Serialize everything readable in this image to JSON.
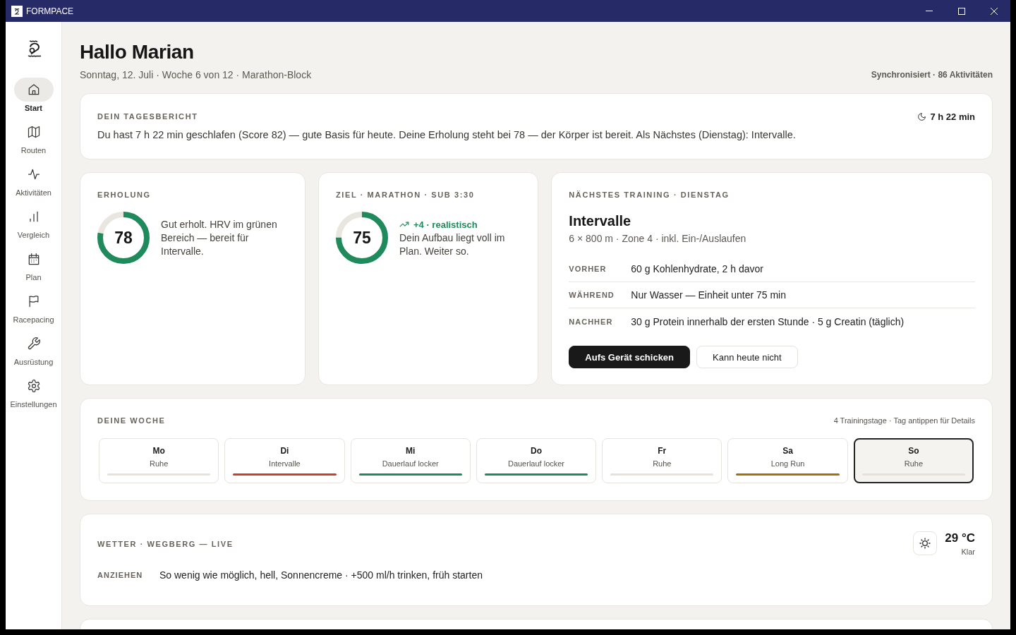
{
  "window": {
    "title": "FORMPACE"
  },
  "sidebar": {
    "items": [
      {
        "label": "Start",
        "selected": true
      },
      {
        "label": "Routen",
        "selected": false
      },
      {
        "label": "Aktivitäten",
        "selected": false
      },
      {
        "label": "Vergleich",
        "selected": false
      },
      {
        "label": "Plan",
        "selected": false
      },
      {
        "label": "Racepacing",
        "selected": false
      },
      {
        "label": "Ausrüstung",
        "selected": false
      },
      {
        "label": "Einstellungen",
        "selected": false
      }
    ]
  },
  "header": {
    "title": "Hallo Marian",
    "subtitle": "Sonntag, 12. Juli · Woche 6 von 12 · Marathon-Block",
    "sync_status": "Synchronisiert · 86 Aktivitäten"
  },
  "daily_report": {
    "heading": "DEIN TAGESBERICHT",
    "sleep": "7 h 22 min",
    "text": "Du hast 7 h 22 min geschlafen (Score 82) — gute Basis für heute. Deine Erholung steht bei 78 — der Körper ist bereit. Als Nächstes (Dienstag): Intervalle."
  },
  "recovery": {
    "heading": "ERHOLUNG",
    "score": "78",
    "level": 0.78,
    "text": "Gut erholt. HRV im grünen Bereich — bereit für Intervalle."
  },
  "goal": {
    "heading": "ZIEL · MARATHON · SUB 3:30",
    "score": "75",
    "level": 0.75,
    "trend": "+4 · realistisch",
    "text": "Dein Aufbau liegt voll im Plan. Weiter so."
  },
  "next_training": {
    "heading": "NÄCHSTES TRAINING · DIENSTAG",
    "title": "Intervalle",
    "details": "6 × 800 m · Zone 4 · inkl. Ein-/Auslaufen",
    "nutrition": [
      {
        "label": "VORHER",
        "text": "60 g Kohlenhydrate, 2 h davor"
      },
      {
        "label": "WÄHREND",
        "text": "Nur Wasser — Einheit unter 75 min"
      },
      {
        "label": "NACHHER",
        "text": "30 g Protein innerhalb der ersten Stunde · 5 g Creatin (täglich)"
      }
    ],
    "buttons": [
      {
        "label": "Aufs Gerät schicken",
        "kind": "primary"
      },
      {
        "label": "Kann heute nicht",
        "kind": "secondary"
      }
    ]
  },
  "week": {
    "heading": "DEINE WOCHE",
    "hint": "4 Trainingstage · Tag antippen für Details",
    "days": [
      {
        "day": "Mo",
        "workout": "Ruhe",
        "color": "#e6e2d9",
        "selected": false
      },
      {
        "day": "Di",
        "workout": "Intervalle",
        "color": "#c8402c",
        "selected": false
      },
      {
        "day": "Mi",
        "workout": "Dauerlauf locker",
        "color": "#1f8a5b",
        "selected": false
      },
      {
        "day": "Do",
        "workout": "Dauerlauf locker",
        "color": "#1f8a5b",
        "selected": false
      },
      {
        "day": "Fr",
        "workout": "Ruhe",
        "color": "#e6e2d9",
        "selected": false
      },
      {
        "day": "Sa",
        "workout": "Long Run",
        "color": "#a5700a",
        "selected": false
      },
      {
        "day": "So",
        "workout": "Ruhe",
        "color": "#e6e2d9",
        "selected": true
      }
    ]
  },
  "weather": {
    "heading": "WETTER · WEGBERG — LIVE",
    "temperature": "29 °C",
    "condition": "Klar",
    "clothing_label": "ANZIEHEN",
    "clothing": "So wenig wie möglich, hell, Sonnencreme · +500 ml/h trinken, früh starten"
  }
}
